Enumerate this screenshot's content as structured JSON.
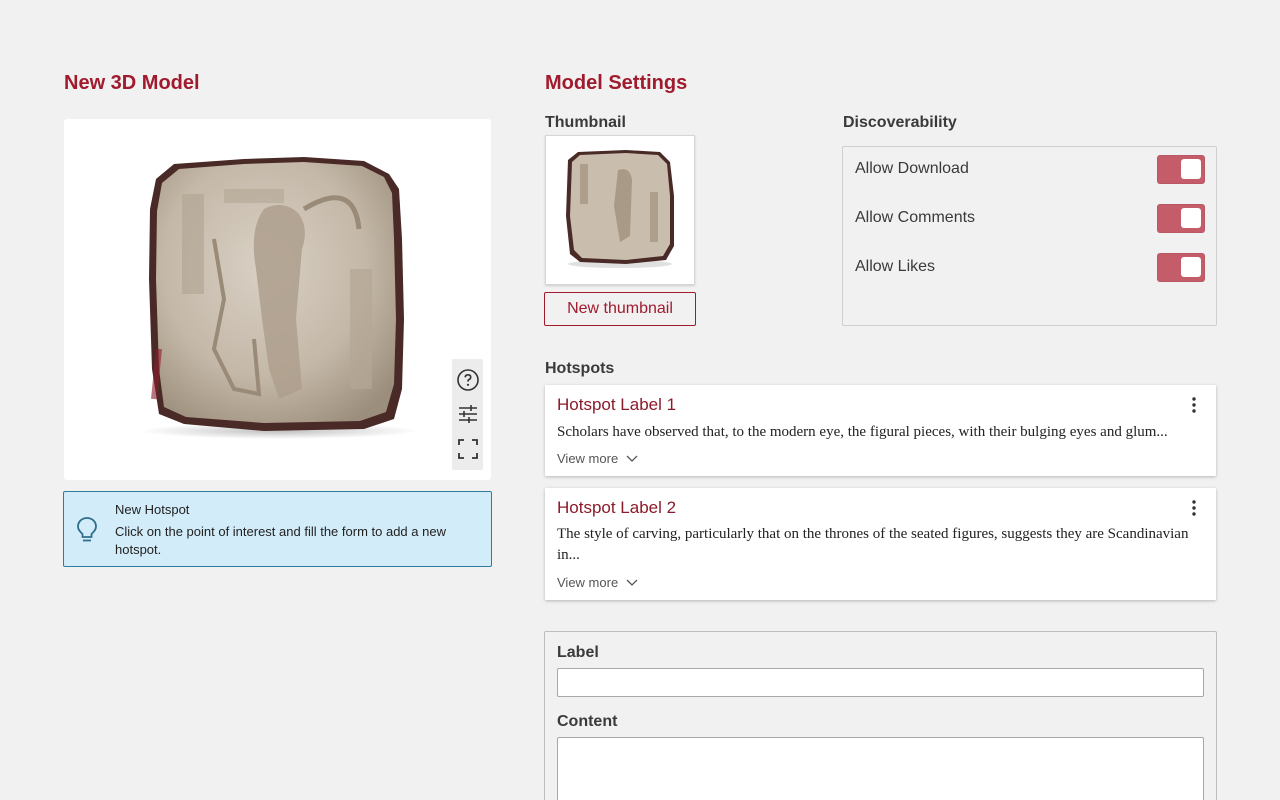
{
  "left": {
    "title": "New 3D Model",
    "viewer": {
      "tools": [
        "help-icon",
        "sliders-icon",
        "fullscreen-icon"
      ]
    },
    "hint": {
      "icon": "lightbulb-icon",
      "title": "New Hotspot",
      "text": "Click on the point of interest and fill the form to add a new hotspot."
    }
  },
  "right": {
    "title": "Model Settings",
    "thumbnail": {
      "label": "Thumbnail",
      "button_label": "New thumbnail"
    },
    "discoverability": {
      "label": "Discoverability",
      "toggles": [
        {
          "label": "Allow Download",
          "on": true
        },
        {
          "label": "Allow Comments",
          "on": true
        },
        {
          "label": "Allow Likes",
          "on": true
        }
      ]
    },
    "hotspots": {
      "label": "Hotspots",
      "items": [
        {
          "title": "Hotspot Label 1",
          "body": "Scholars have observed that, to the modern eye, the figural pieces, with their bulging eyes and glum...",
          "more": "View more"
        },
        {
          "title": "Hotspot Label 2",
          "body": "The style of carving, particularly that on the thrones of the seated figures, suggests they are Scandinavian in...",
          "more": "View more"
        }
      ]
    },
    "form": {
      "label_field": "Label",
      "label_value": "",
      "content_field": "Content",
      "content_value": ""
    }
  },
  "colors": {
    "accent": "#a01b2e",
    "toggle_on": "#c45c6a",
    "hint_bg": "#d3ecf9",
    "hint_border": "#2f7c9c",
    "page_bg": "#f1f1f1"
  }
}
